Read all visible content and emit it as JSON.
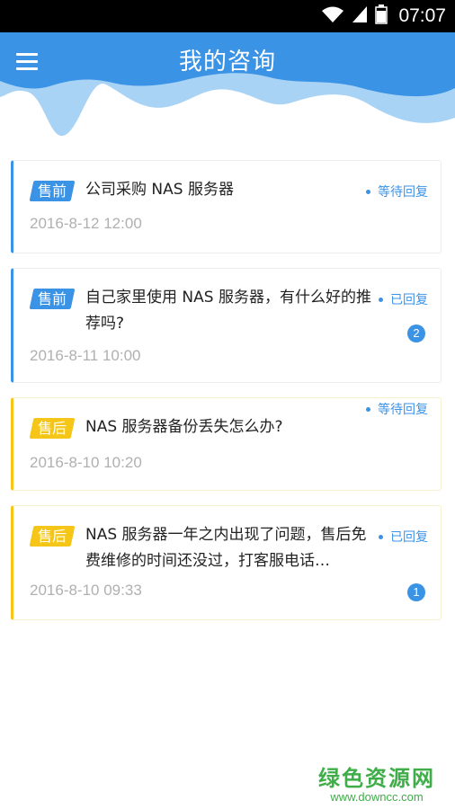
{
  "status_bar": {
    "time": "07:07"
  },
  "header": {
    "title": "我的咨询"
  },
  "consultations": [
    {
      "tag": "售前",
      "title": "公司采购 NAS 服务器",
      "date": "2016-8-12 12:00",
      "status": "等待回复",
      "badge": ""
    },
    {
      "tag": "售前",
      "title": "自己家里使用 NAS 服务器，有什么好的推荐吗?",
      "date": "2016-8-11 10:00",
      "status": "已回复",
      "badge": "2"
    },
    {
      "tag": "售后",
      "title": "NAS 服务器备份丢失怎么办?",
      "date": "2016-8-10 10:20",
      "status": "等待回复",
      "badge": ""
    },
    {
      "tag": "售后",
      "title": "NAS 服务器一年之内出现了问题，售后免费维修的时间还没过，打客服电话…",
      "date": "2016-8-10 09:33",
      "status": "已回复",
      "badge": "1"
    }
  ],
  "watermark": {
    "name": "绿色资源网",
    "url": "www.downcc.com"
  },
  "colors": {
    "primary": "#3b93e6",
    "after_sale": "#f5c518",
    "wave_light": "#a9d3f5"
  }
}
